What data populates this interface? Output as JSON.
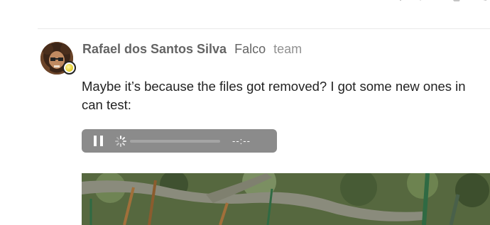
{
  "topbar": {
    "icons": [
      "like-count-icon",
      "heart-icon",
      "link-icon"
    ]
  },
  "post": {
    "author": {
      "full_name": "Rafael dos Santos Silva",
      "username": "Falco",
      "group": "team",
      "avatar_icon": "avatar",
      "status_icon": "status-icon"
    },
    "body_lines": [
      "Maybe it’s because the files got removed? I got some new ones in",
      "can test:"
    ],
    "audio": {
      "play_state_icon": "pause-icon",
      "loading_icon": "spinner-icon",
      "time": "--:--",
      "progress": 0
    },
    "image": {
      "description_icon": "photo"
    }
  },
  "colors": {
    "name": "#646464",
    "group": "#919191",
    "text": "#222222",
    "player_bg": "#8b8b8b",
    "player_track": "#a4a4a4",
    "divider": "#e9e9e9"
  }
}
